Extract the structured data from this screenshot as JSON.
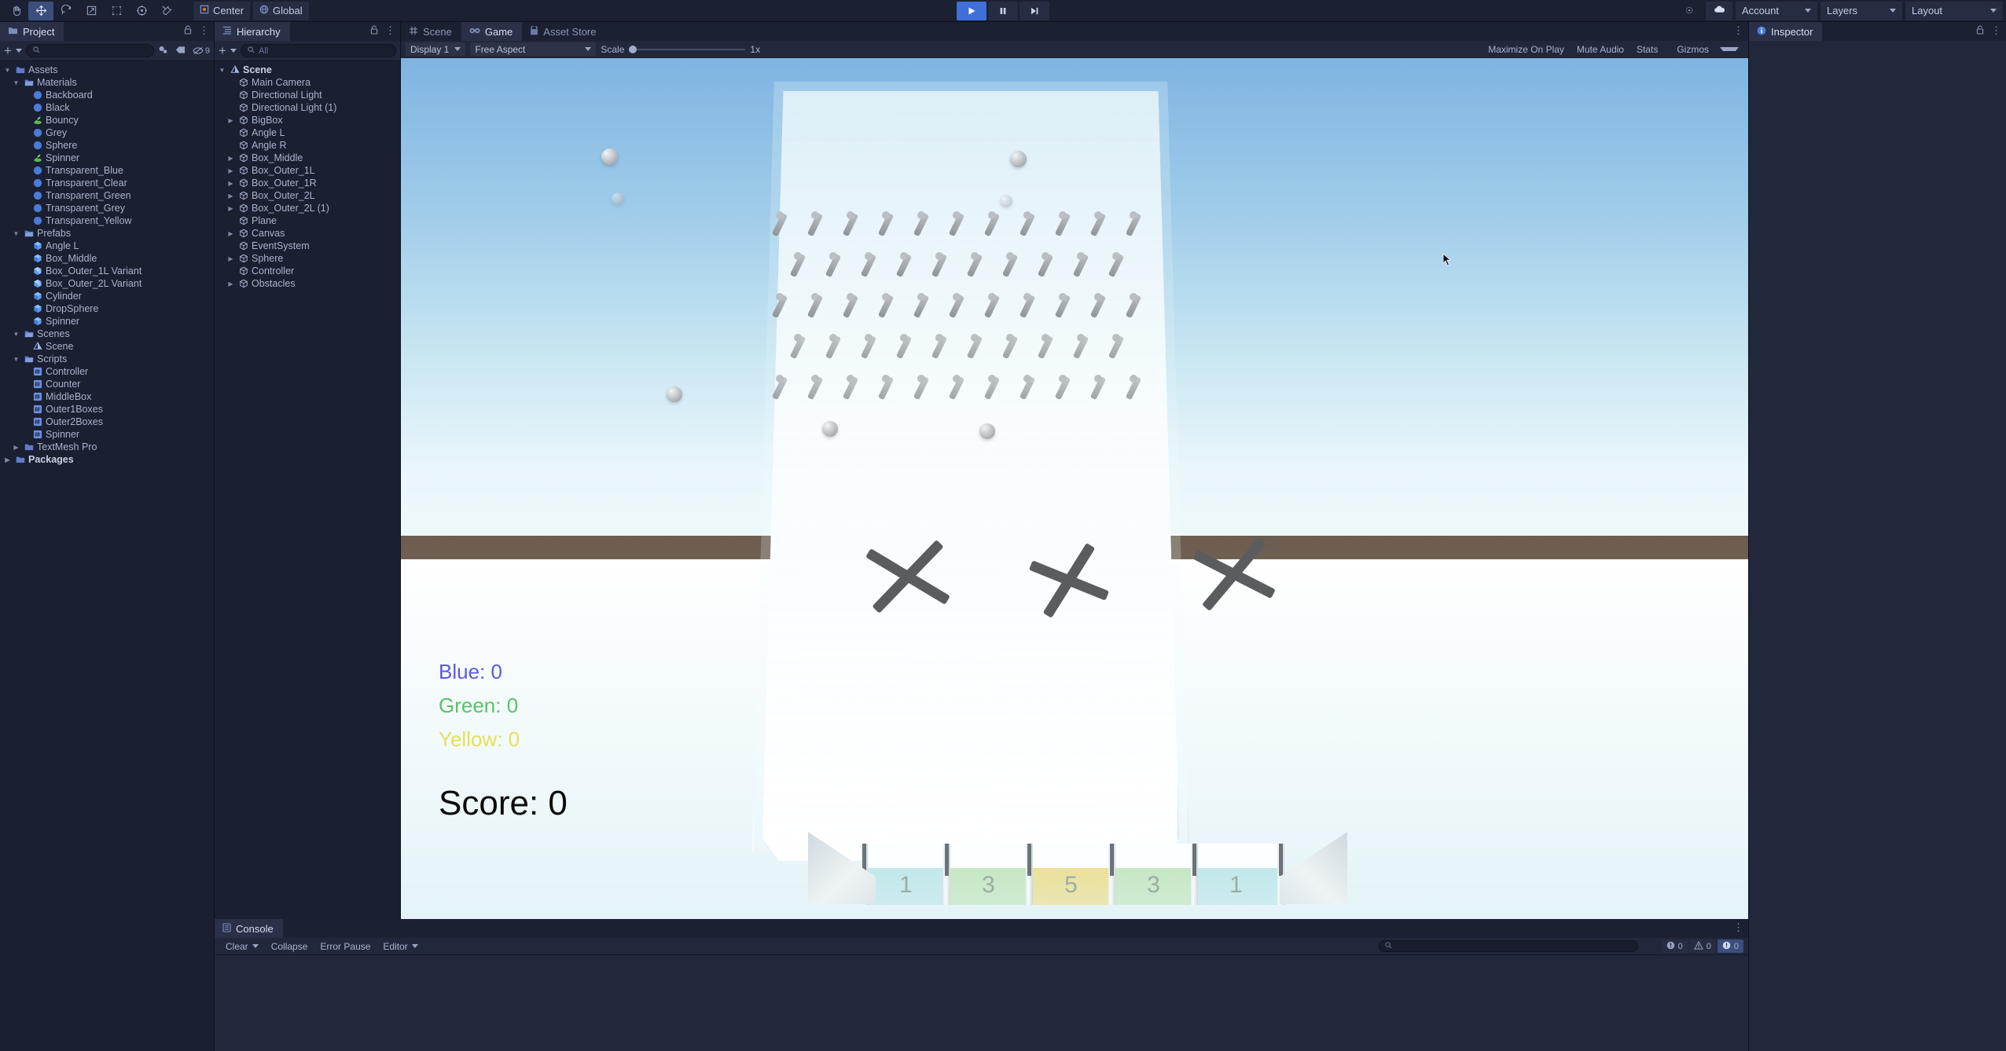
{
  "toolbar": {
    "tools": [
      {
        "name": "hand-tool",
        "icon": "hand",
        "selected": false
      },
      {
        "name": "move-tool",
        "icon": "move",
        "selected": true
      },
      {
        "name": "rotate-tool",
        "icon": "rotate",
        "selected": false
      },
      {
        "name": "scale-tool",
        "icon": "scale",
        "selected": false
      },
      {
        "name": "rect-tool",
        "icon": "rect",
        "selected": false
      },
      {
        "name": "transform-tool",
        "icon": "transform",
        "selected": false
      },
      {
        "name": "custom-tool",
        "icon": "wrench",
        "selected": false
      }
    ],
    "pivot_label": "Center",
    "handle_label": "Global",
    "play_label": "▶",
    "pause_label": "❙❙",
    "step_label": "▶❙",
    "collab_label": "",
    "account_label": "Account",
    "layers_label": "Layers",
    "layout_label": "Layout"
  },
  "project": {
    "tab_label": "Project",
    "search_placeholder": "",
    "hidden_count": "9",
    "tree": [
      {
        "label": "Assets",
        "depth": 0,
        "icon": "folder",
        "arrow": "down",
        "bold": false
      },
      {
        "label": "Materials",
        "depth": 1,
        "icon": "folder-open",
        "arrow": "down",
        "bold": false
      },
      {
        "label": "Backboard",
        "depth": 2,
        "icon": "material",
        "arrow": "",
        "bold": false
      },
      {
        "label": "Black",
        "depth": 2,
        "icon": "material",
        "arrow": "",
        "bold": false
      },
      {
        "label": "Bouncy",
        "depth": 2,
        "icon": "physic",
        "arrow": "",
        "bold": false
      },
      {
        "label": "Grey",
        "depth": 2,
        "icon": "material",
        "arrow": "",
        "bold": false
      },
      {
        "label": "Sphere",
        "depth": 2,
        "icon": "material",
        "arrow": "",
        "bold": false
      },
      {
        "label": "Spinner",
        "depth": 2,
        "icon": "physic",
        "arrow": "",
        "bold": false
      },
      {
        "label": "Transparent_Blue",
        "depth": 2,
        "icon": "material",
        "arrow": "",
        "bold": false
      },
      {
        "label": "Transparent_Clear",
        "depth": 2,
        "icon": "material",
        "arrow": "",
        "bold": false
      },
      {
        "label": "Transparent_Green",
        "depth": 2,
        "icon": "material",
        "arrow": "",
        "bold": false
      },
      {
        "label": "Transparent_Grey",
        "depth": 2,
        "icon": "material",
        "arrow": "",
        "bold": false
      },
      {
        "label": "Transparent_Yellow",
        "depth": 2,
        "icon": "material",
        "arrow": "",
        "bold": false
      },
      {
        "label": "Prefabs",
        "depth": 1,
        "icon": "folder-open",
        "arrow": "down",
        "bold": false
      },
      {
        "label": "Angle L",
        "depth": 2,
        "icon": "prefab",
        "arrow": "",
        "bold": false
      },
      {
        "label": "Box_Middle",
        "depth": 2,
        "icon": "prefab",
        "arrow": "",
        "bold": false
      },
      {
        "label": "Box_Outer_1L Variant",
        "depth": 2,
        "icon": "prefab-variant",
        "arrow": "",
        "bold": false
      },
      {
        "label": "Box_Outer_2L Variant",
        "depth": 2,
        "icon": "prefab-variant",
        "arrow": "",
        "bold": false
      },
      {
        "label": "Cylinder",
        "depth": 2,
        "icon": "prefab",
        "arrow": "",
        "bold": false
      },
      {
        "label": "DropSphere",
        "depth": 2,
        "icon": "prefab",
        "arrow": "",
        "bold": false
      },
      {
        "label": "Spinner",
        "depth": 2,
        "icon": "prefab",
        "arrow": "",
        "bold": false
      },
      {
        "label": "Scenes",
        "depth": 1,
        "icon": "folder-open",
        "arrow": "down",
        "bold": false
      },
      {
        "label": "Scene",
        "depth": 2,
        "icon": "scene",
        "arrow": "",
        "bold": false
      },
      {
        "label": "Scripts",
        "depth": 1,
        "icon": "folder-open",
        "arrow": "down",
        "bold": false
      },
      {
        "label": "Controller",
        "depth": 2,
        "icon": "script",
        "arrow": "",
        "bold": false
      },
      {
        "label": "Counter",
        "depth": 2,
        "icon": "script",
        "arrow": "",
        "bold": false
      },
      {
        "label": "MiddleBox",
        "depth": 2,
        "icon": "script",
        "arrow": "",
        "bold": false
      },
      {
        "label": "Outer1Boxes",
        "depth": 2,
        "icon": "script",
        "arrow": "",
        "bold": false
      },
      {
        "label": "Outer2Boxes",
        "depth": 2,
        "icon": "script",
        "arrow": "",
        "bold": false
      },
      {
        "label": "Spinner",
        "depth": 2,
        "icon": "script",
        "arrow": "",
        "bold": false
      },
      {
        "label": "TextMesh Pro",
        "depth": 1,
        "icon": "folder",
        "arrow": "right",
        "bold": false
      },
      {
        "label": "Packages",
        "depth": 0,
        "icon": "folder",
        "arrow": "right",
        "bold": true
      }
    ]
  },
  "hierarchy": {
    "tab_label": "Hierarchy",
    "search_placeholder": "All",
    "tree": [
      {
        "label": "Scene",
        "depth": 0,
        "icon": "scene",
        "arrow": "down",
        "bold": true
      },
      {
        "label": "Main Camera",
        "depth": 1,
        "icon": "gameobject",
        "arrow": "",
        "bold": false
      },
      {
        "label": "Directional Light",
        "depth": 1,
        "icon": "gameobject",
        "arrow": "",
        "bold": false
      },
      {
        "label": "Directional Light (1)",
        "depth": 1,
        "icon": "gameobject",
        "arrow": "",
        "bold": false
      },
      {
        "label": "BigBox",
        "depth": 1,
        "icon": "gameobject",
        "arrow": "right",
        "bold": false
      },
      {
        "label": "Angle L",
        "depth": 1,
        "icon": "gameobject",
        "arrow": "",
        "bold": false
      },
      {
        "label": "Angle R",
        "depth": 1,
        "icon": "gameobject",
        "arrow": "",
        "bold": false
      },
      {
        "label": "Box_Middle",
        "depth": 1,
        "icon": "gameobject",
        "arrow": "right",
        "bold": false
      },
      {
        "label": "Box_Outer_1L",
        "depth": 1,
        "icon": "gameobject",
        "arrow": "right",
        "bold": false
      },
      {
        "label": "Box_Outer_1R",
        "depth": 1,
        "icon": "gameobject",
        "arrow": "right",
        "bold": false
      },
      {
        "label": "Box_Outer_2L",
        "depth": 1,
        "icon": "gameobject",
        "arrow": "right",
        "bold": false
      },
      {
        "label": "Box_Outer_2L (1)",
        "depth": 1,
        "icon": "gameobject",
        "arrow": "right",
        "bold": false
      },
      {
        "label": "Plane",
        "depth": 1,
        "icon": "gameobject",
        "arrow": "",
        "bold": false
      },
      {
        "label": "Canvas",
        "depth": 1,
        "icon": "gameobject",
        "arrow": "right",
        "bold": false
      },
      {
        "label": "EventSystem",
        "depth": 1,
        "icon": "gameobject",
        "arrow": "",
        "bold": false
      },
      {
        "label": "Sphere",
        "depth": 1,
        "icon": "gameobject",
        "arrow": "right",
        "bold": false
      },
      {
        "label": "Controller",
        "depth": 1,
        "icon": "gameobject",
        "arrow": "",
        "bold": false
      },
      {
        "label": "Obstacles",
        "depth": 1,
        "icon": "gameobject",
        "arrow": "right",
        "bold": false
      }
    ]
  },
  "gameview": {
    "tabs": [
      {
        "label": "Scene",
        "icon": "scene-grid-icon",
        "active": false
      },
      {
        "label": "Game",
        "icon": "gamepad-icon",
        "active": true
      },
      {
        "label": "Asset Store",
        "icon": "store-icon",
        "active": false
      }
    ],
    "display_label": "Display 1",
    "aspect_label": "Free Aspect",
    "scale_label": "Scale",
    "scale_value": "1x",
    "maximize_label": "Maximize On Play",
    "mute_label": "Mute Audio",
    "stats_label": "Stats",
    "gizmos_label": "Gizmos",
    "hud": {
      "blue": {
        "text": "Blue: 0",
        "color": "#5b5bd6"
      },
      "green": {
        "text": "Green: 0",
        "color": "#57c364"
      },
      "yellow": {
        "text": "Yellow: 0",
        "color": "#e3e157"
      },
      "score": {
        "text": "Score: 0",
        "color": "#0a0a0a"
      }
    },
    "slots": [
      {
        "value": "1",
        "color": "#bfe7ea"
      },
      {
        "value": "3",
        "color": "#c3e7c0"
      },
      {
        "value": "5",
        "color": "#ecdf92"
      },
      {
        "value": "3",
        "color": "#c3e7c0"
      },
      {
        "value": "1",
        "color": "#bfe7ea"
      }
    ]
  },
  "console": {
    "tab_label": "Console",
    "clear_label": "Clear",
    "collapse_label": "Collapse",
    "error_pause_label": "Error Pause",
    "editor_label": "Editor",
    "search_placeholder": "",
    "counts": {
      "log": "0",
      "warn": "0",
      "error": "0"
    }
  },
  "inspector": {
    "tab_label": "Inspector"
  }
}
